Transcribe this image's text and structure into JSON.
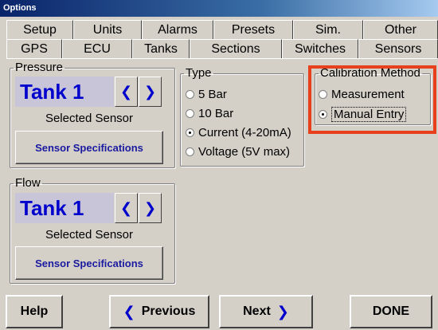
{
  "window": {
    "title": "Options"
  },
  "tabs_row1": [
    "Setup",
    "Units",
    "Alarms",
    "Presets",
    "Sim.",
    "Other"
  ],
  "tabs_row2": [
    "GPS",
    "ECU",
    "Tanks",
    "Sections",
    "Switches",
    "Sensors"
  ],
  "active_tab": "Sensors",
  "pressure": {
    "group_label": "Pressure",
    "tank": "Tank 1",
    "selected_label": "Selected Sensor",
    "spec_button": "Sensor Specifications"
  },
  "type": {
    "group_label": "Type",
    "options": [
      "5 Bar",
      "10 Bar",
      "Current (4-20mA)",
      "Voltage (5V max)"
    ],
    "selected": "Current (4-20mA)"
  },
  "calibration": {
    "group_label": "Calibration Method",
    "options": [
      "Measurement",
      "Manual Entry"
    ],
    "selected": "Manual Entry"
  },
  "flow": {
    "group_label": "Flow",
    "tank": "Tank 1",
    "selected_label": "Selected Sensor",
    "spec_button": "Sensor Specifications"
  },
  "footer": {
    "help": "Help",
    "previous": "Previous",
    "next": "Next",
    "done": "DONE"
  },
  "colors": {
    "accent_blue": "#0000cc",
    "highlight": "#e8401c"
  },
  "icons": {
    "prev": "chevron-left-icon",
    "next": "chevron-right-icon"
  }
}
